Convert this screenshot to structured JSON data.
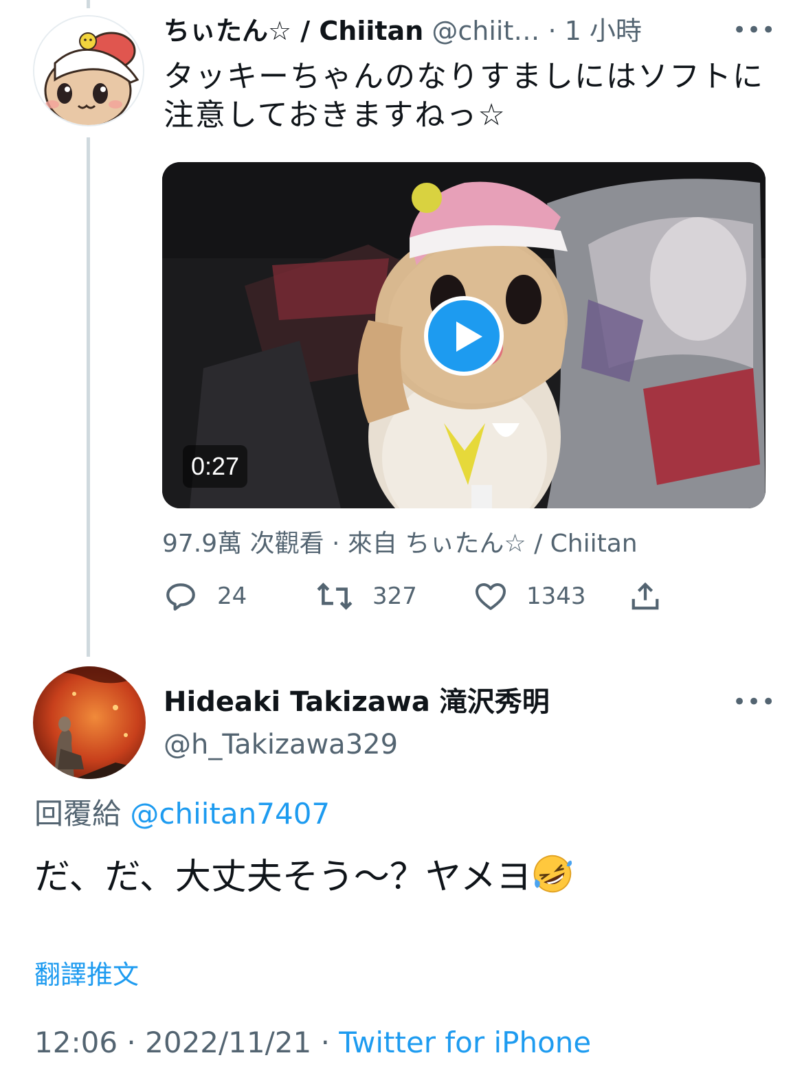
{
  "parent_tweet": {
    "display_name": "ちぃたん☆ / Chiitan",
    "handle": "@chiit…",
    "separator": "·",
    "time_ago": "1 小時",
    "text": "タッキーちゃんのなりすましにはソフトに注意しておきますねっ☆",
    "video": {
      "duration": "0:27",
      "views_line": "97.9萬 次觀看 · 來自 ちぃたん☆ / Chiitan"
    },
    "actions": {
      "replies": "24",
      "retweets": "327",
      "likes": "1343"
    }
  },
  "focused_tweet": {
    "display_name": "Hideaki Takizawa 滝沢秀明",
    "handle": "@h_Takizawa329",
    "reply_prefix": "回覆給",
    "reply_mention": "@chiitan7407",
    "text": "だ、だ、大丈夫そう～？ヤメヨ",
    "translate_link": "翻譯推文",
    "time": "12:06",
    "date": "2022/11/21",
    "separator": "·",
    "source": "Twitter for iPhone"
  },
  "icons": {
    "more": "more-options-icon",
    "reply": "reply-icon",
    "retweet": "retweet-icon",
    "like": "heart-icon",
    "share": "share-icon",
    "play": "play-icon",
    "emoji": "rolling-on-floor-laughing-emoji"
  },
  "colors": {
    "accent": "#1d9bf0",
    "secondary_text": "#536471",
    "primary_text": "#0f1419",
    "thread_line": "#cfd9de"
  }
}
